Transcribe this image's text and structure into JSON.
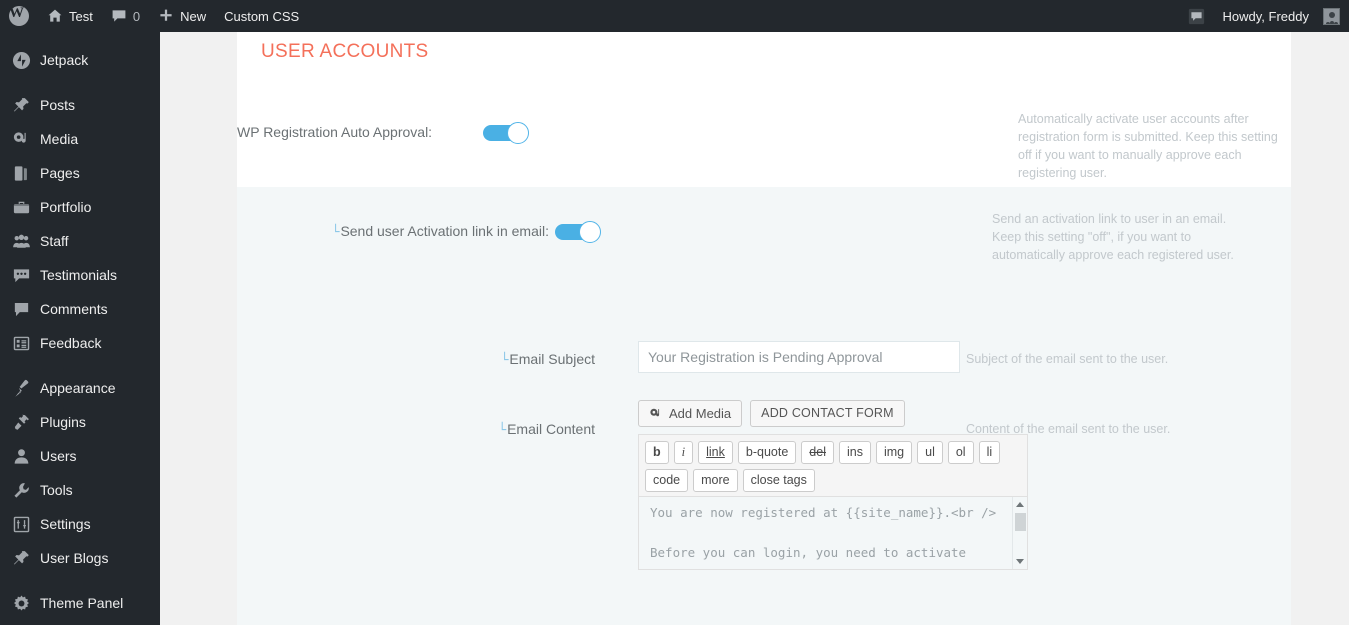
{
  "adminbar": {
    "logo_icon": "wordpress-logo-icon",
    "site_name": "Test",
    "home_icon": "home-icon",
    "comments_icon": "comment-bubble-icon",
    "comments_count": "0",
    "new_icon": "plus-icon",
    "new_label": "New",
    "custom_css_label": "Custom CSS",
    "notifications_icon": "notification-bubble-icon",
    "howdy_label": "Howdy, Freddy",
    "avatar_icon": "user-avatar-icon"
  },
  "sidebar": {
    "items": [
      {
        "label": "Jetpack",
        "icon": "jetpack-icon"
      },
      {
        "label": "Posts",
        "icon": "pin-icon"
      },
      {
        "label": "Media",
        "icon": "media-icon"
      },
      {
        "label": "Pages",
        "icon": "pages-icon"
      },
      {
        "label": "Portfolio",
        "icon": "portfolio-icon"
      },
      {
        "label": "Staff",
        "icon": "staff-group-icon"
      },
      {
        "label": "Testimonials",
        "icon": "testimonial-quote-icon"
      },
      {
        "label": "Comments",
        "icon": "comment-bubble-icon"
      },
      {
        "label": "Feedback",
        "icon": "feedback-form-icon"
      },
      {
        "label": "Appearance",
        "icon": "paintbrush-icon"
      },
      {
        "label": "Plugins",
        "icon": "plug-icon"
      },
      {
        "label": "Users",
        "icon": "user-icon"
      },
      {
        "label": "Tools",
        "icon": "wrench-icon"
      },
      {
        "label": "Settings",
        "icon": "settings-sliders-icon"
      },
      {
        "label": "User Blogs",
        "icon": "pin-icon"
      },
      {
        "label": "Theme Panel",
        "icon": "gear-icon"
      }
    ]
  },
  "main": {
    "page_title": "USER ACCOUNTS",
    "accent_color": "#f4705a",
    "toggle_on_color": "#4ab0e4",
    "sub_marker": "└",
    "rows": {
      "auto_approval": {
        "label": "WP Registration Auto Approval:",
        "toggle_state": "on",
        "description": "Automatically activate user accounts after registration form is submitted. Keep this setting off if you want to manually approve each registering user."
      },
      "activation_link": {
        "label": "Send user Activation link in email:",
        "toggle_state": "on",
        "description": "Send an activation link to user in an email. Keep this setting \"off\", if you want to automatically approve each registered user."
      },
      "email_subject": {
        "label": "Email Subject",
        "value": "",
        "placeholder": "Your Registration is Pending Approval",
        "description": "Subject of the email sent to the user."
      },
      "email_content": {
        "label": "Email Content",
        "description": "Content of the email sent to the user.",
        "add_media_label": "Add Media",
        "add_media_icon": "media-icon",
        "add_contact_form_label": "ADD CONTACT FORM",
        "quicktags": [
          "b",
          "i",
          "link",
          "b-quote",
          "del",
          "ins",
          "img",
          "ul",
          "ol",
          "li",
          "code",
          "more",
          "close tags"
        ],
        "textarea_value": "You are now registered at {{site_name}}.<br />\n\nBefore you can login, you need to activate",
        "scrollbar_up_icon": "scroll-up-arrow-icon",
        "scrollbar_down_icon": "scroll-down-arrow-icon"
      }
    }
  }
}
